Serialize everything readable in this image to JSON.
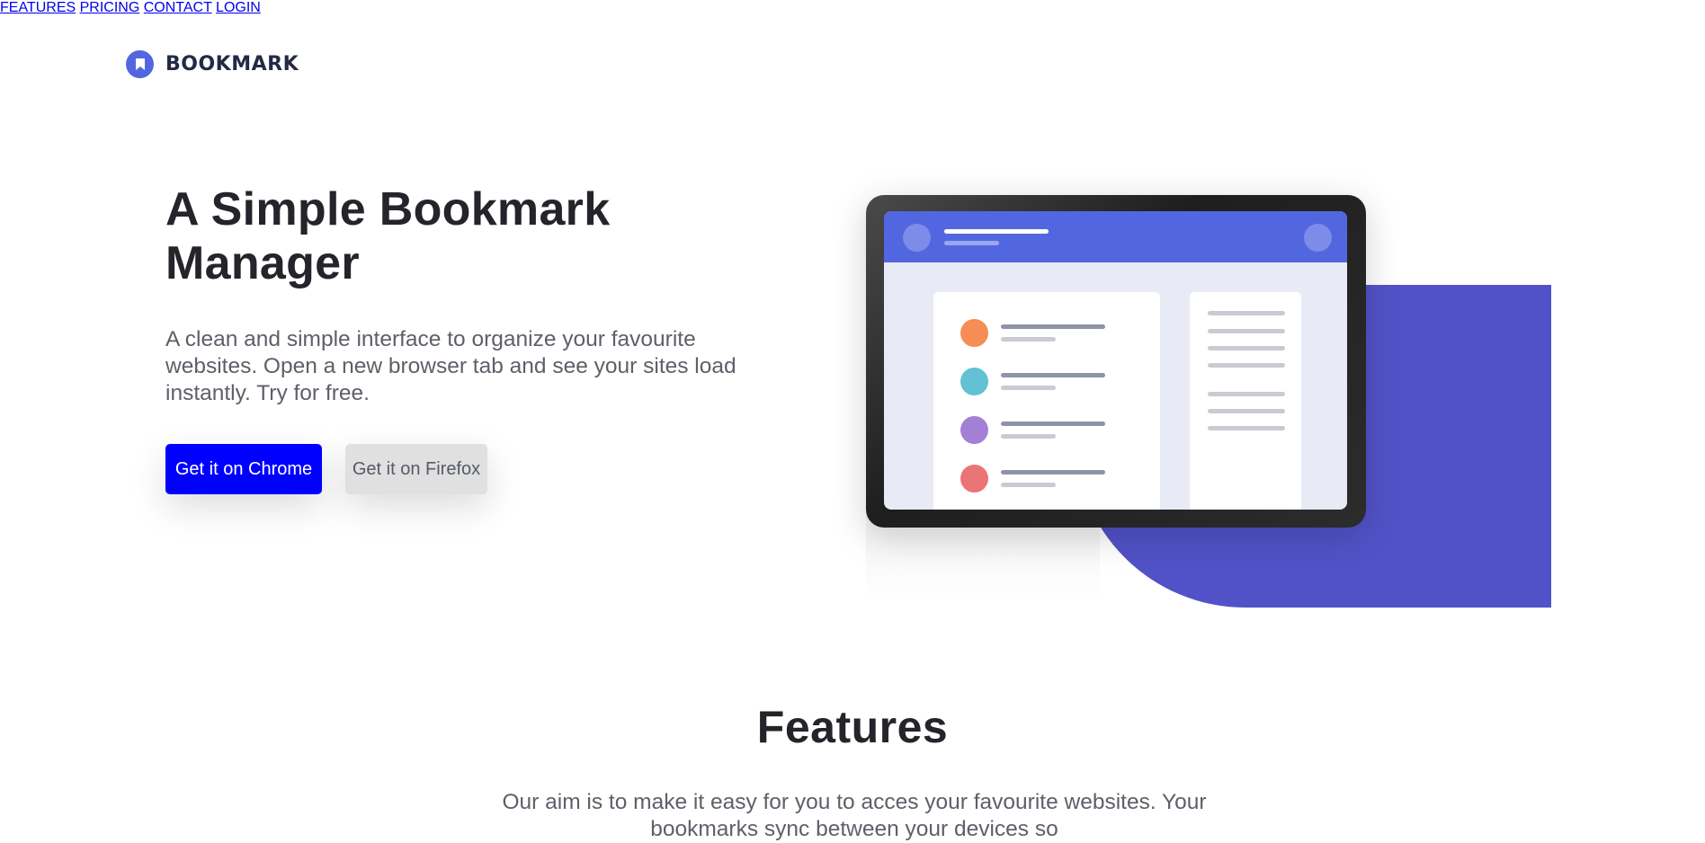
{
  "header": {
    "logo_text": "BOOKMARK",
    "logo_icon": "bookmark-icon",
    "nav": [
      {
        "label": "FEATURES"
      },
      {
        "label": "PRICING"
      },
      {
        "label": "CONTACT"
      },
      {
        "label": "LOGIN"
      }
    ]
  },
  "hero": {
    "title": "A Simple Bookmark Manager",
    "description": "A clean and simple interface to organize your favourite websites. Open a new browser tab and see your sites load instantly. Try for free.",
    "chrome_button": "Get it on Chrome",
    "firefox_button": "Get it on Firefox"
  },
  "illustration": {
    "icon": "tablet-illustration",
    "list_dot_colors": [
      "#f58d54",
      "#62c1d3",
      "#a37fd5",
      "#eb7475"
    ]
  },
  "features": {
    "title": "Features",
    "description": "Our aim is to make it easy for you to acces your favourite websites. Your bookmarks sync between your devices so"
  },
  "colors": {
    "brand": "#5267df",
    "chrome_button": "#0000ff",
    "accent_blob": "#5252c8"
  }
}
